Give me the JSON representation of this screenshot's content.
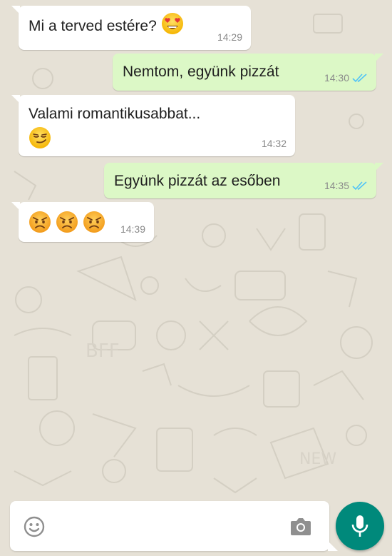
{
  "colors": {
    "incoming_bubble": "#ffffff",
    "outgoing_bubble": "#dcf8c6",
    "read_ticks": "#4fc3f7",
    "mic_button": "#00897b",
    "wallpaper": "#e6e1d6"
  },
  "messages": [
    {
      "direction": "incoming",
      "text": "Mi a terved estére?",
      "emoji": [
        "heart-eyes-emoji"
      ],
      "time": "14:29"
    },
    {
      "direction": "outgoing",
      "text": "Nemtom, együnk pizzát",
      "time": "14:30",
      "status": "read"
    },
    {
      "direction": "incoming",
      "text": "Valami romantikusabbat...",
      "emoji": [
        "smirk-emoji"
      ],
      "time": "14:32"
    },
    {
      "direction": "outgoing",
      "text": "Együnk pizzát az esőben",
      "time": "14:35",
      "status": "read"
    },
    {
      "direction": "incoming",
      "text": "",
      "emoji": [
        "angry-emoji",
        "angry-emoji",
        "angry-emoji"
      ],
      "time": "14:39"
    }
  ],
  "composer": {
    "placeholder": "",
    "value": "",
    "left_icon": "emoji-icon",
    "right_icon": "camera-icon",
    "send_icon": "microphone-icon"
  }
}
